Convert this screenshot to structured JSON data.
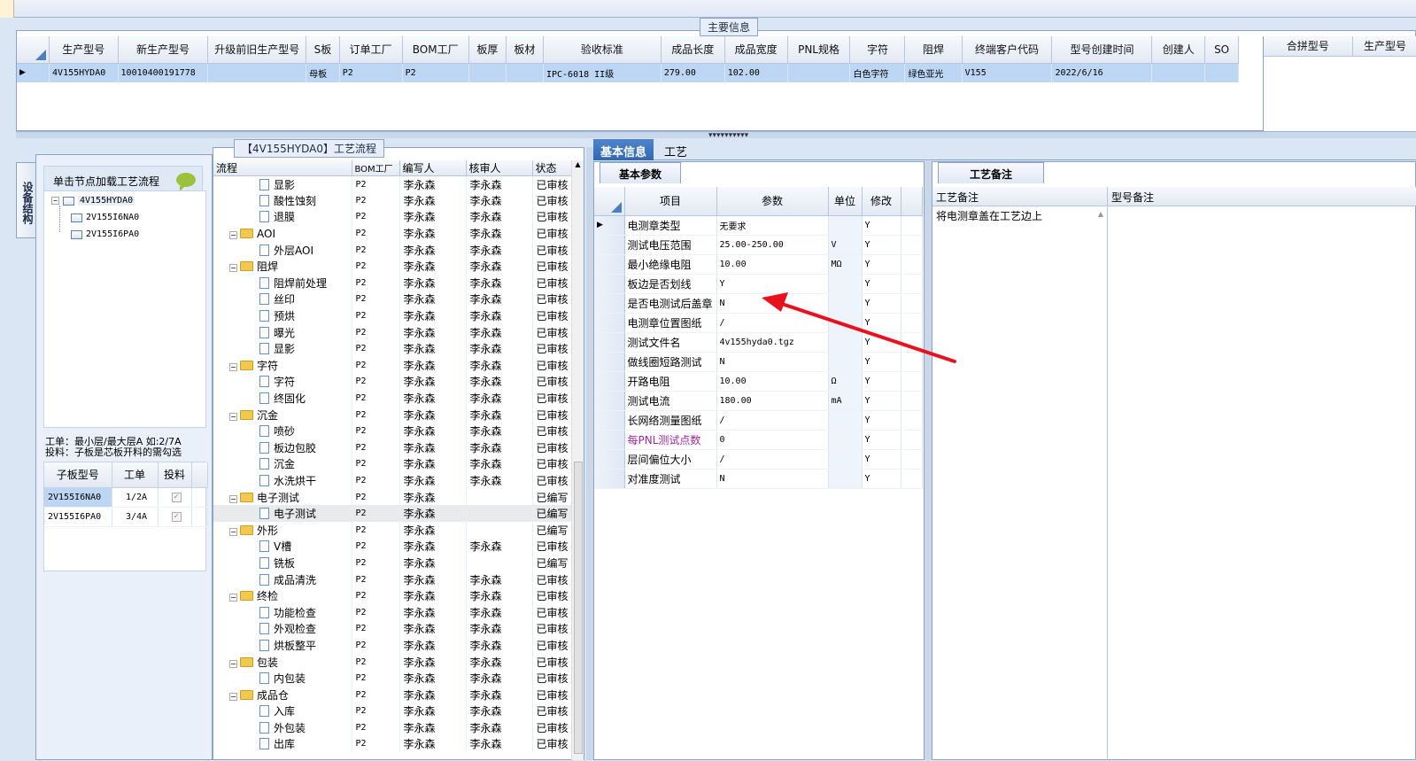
{
  "main_info": {
    "legend": "主要信息",
    "columns": [
      "生产型号",
      "新生产型号",
      "升级前旧生产型号",
      "S板",
      "订单工厂",
      "BOM工厂",
      "板厚",
      "板材",
      "验收标准",
      "成品长度",
      "成品宽度",
      "PNL规格",
      "字符",
      "阻焊",
      "终端客户代码",
      "型号创建时间",
      "创建人",
      "SO"
    ],
    "row": [
      "4V155HYDA0",
      "10010400191778",
      "",
      "母板",
      "P2",
      "P2",
      "",
      "",
      "IPC-6018 II级",
      "279.00",
      "102.00",
      "",
      "白色字符",
      "绿色亚光",
      "V155",
      "2022/6/16",
      "",
      ""
    ],
    "right_columns": [
      "合拼型号",
      "生产型号"
    ]
  },
  "left_panel": {
    "side_tab": "设备结构",
    "hint": "单击节点加载工艺流程",
    "tree": [
      {
        "label": "4V155HYDA0",
        "level": 0,
        "expanded": true
      },
      {
        "label": "2V155I6NA0",
        "level": 1
      },
      {
        "label": "2V155I6PA0",
        "level": 1
      }
    ],
    "note_line1": "工单：最小层/最大层A 如:2/7A",
    "note_line2": "投料：子板是芯板开料的需勾选",
    "sub_columns": [
      "子板型号",
      "工单",
      "投料"
    ],
    "sub_rows": [
      {
        "model": "2V155I6NA0",
        "order": "1/2A",
        "feed": "✓"
      },
      {
        "model": "2V155I6PA0",
        "order": "3/4A",
        "feed": "✓"
      }
    ]
  },
  "process": {
    "legend": "【4V155HYDA0】工艺流程",
    "columns": [
      "流程",
      "BOM工厂",
      "编写人",
      "核审人",
      "状态"
    ],
    "rows": [
      {
        "name": "显影",
        "type": "doc",
        "indent": 2,
        "bom": "P2",
        "writer": "李永森",
        "reviewer": "李永森",
        "status": "已审核"
      },
      {
        "name": "酸性蚀刻",
        "type": "doc",
        "indent": 2,
        "bom": "P2",
        "writer": "李永森",
        "reviewer": "李永森",
        "status": "已审核"
      },
      {
        "name": "退膜",
        "type": "doc",
        "indent": 2,
        "bom": "P2",
        "writer": "李永森",
        "reviewer": "李永森",
        "status": "已审核"
      },
      {
        "name": "AOI",
        "type": "folder",
        "indent": 1,
        "bom": "P2",
        "writer": "李永森",
        "reviewer": "李永森",
        "status": "已审核"
      },
      {
        "name": "外层AOI",
        "type": "doc",
        "indent": 2,
        "bom": "P2",
        "writer": "李永森",
        "reviewer": "李永森",
        "status": "已审核"
      },
      {
        "name": "阻焊",
        "type": "folder",
        "indent": 1,
        "bom": "P2",
        "writer": "李永森",
        "reviewer": "李永森",
        "status": "已审核"
      },
      {
        "name": "阻焊前处理",
        "type": "doc",
        "indent": 2,
        "bom": "P2",
        "writer": "李永森",
        "reviewer": "李永森",
        "status": "已审核"
      },
      {
        "name": "丝印",
        "type": "doc",
        "indent": 2,
        "bom": "P2",
        "writer": "李永森",
        "reviewer": "李永森",
        "status": "已审核"
      },
      {
        "name": "预烘",
        "type": "doc",
        "indent": 2,
        "bom": "P2",
        "writer": "李永森",
        "reviewer": "李永森",
        "status": "已审核"
      },
      {
        "name": "曝光",
        "type": "doc",
        "indent": 2,
        "bom": "P2",
        "writer": "李永森",
        "reviewer": "李永森",
        "status": "已审核"
      },
      {
        "name": "显影",
        "type": "doc",
        "indent": 2,
        "bom": "P2",
        "writer": "李永森",
        "reviewer": "李永森",
        "status": "已审核"
      },
      {
        "name": "字符",
        "type": "folder",
        "indent": 1,
        "bom": "P2",
        "writer": "李永森",
        "reviewer": "李永森",
        "status": "已审核"
      },
      {
        "name": "字符",
        "type": "doc",
        "indent": 2,
        "bom": "P2",
        "writer": "李永森",
        "reviewer": "李永森",
        "status": "已审核"
      },
      {
        "name": "终固化",
        "type": "doc",
        "indent": 2,
        "bom": "P2",
        "writer": "李永森",
        "reviewer": "李永森",
        "status": "已审核"
      },
      {
        "name": "沉金",
        "type": "folder",
        "indent": 1,
        "bom": "P2",
        "writer": "李永森",
        "reviewer": "李永森",
        "status": "已审核"
      },
      {
        "name": "喷砂",
        "type": "doc",
        "indent": 2,
        "bom": "P2",
        "writer": "李永森",
        "reviewer": "李永森",
        "status": "已审核"
      },
      {
        "name": "板边包胶",
        "type": "doc",
        "indent": 2,
        "bom": "P2",
        "writer": "李永森",
        "reviewer": "李永森",
        "status": "已审核"
      },
      {
        "name": "沉金",
        "type": "doc",
        "indent": 2,
        "bom": "P2",
        "writer": "李永森",
        "reviewer": "李永森",
        "status": "已审核"
      },
      {
        "name": "水洗烘干",
        "type": "doc",
        "indent": 2,
        "bom": "P2",
        "writer": "李永森",
        "reviewer": "李永森",
        "status": "已审核"
      },
      {
        "name": "电子测试",
        "type": "folder",
        "indent": 1,
        "bom": "P2",
        "writer": "李永森",
        "reviewer": "",
        "status": "已编写"
      },
      {
        "name": "电子测试",
        "type": "doc",
        "indent": 2,
        "bom": "P2",
        "writer": "李永森",
        "reviewer": "",
        "status": "已编写",
        "highlight": true
      },
      {
        "name": "外形",
        "type": "folder",
        "indent": 1,
        "bom": "P2",
        "writer": "李永森",
        "reviewer": "",
        "status": "已编写"
      },
      {
        "name": "V槽",
        "type": "doc",
        "indent": 2,
        "bom": "P2",
        "writer": "李永森",
        "reviewer": "李永森",
        "status": "已审核"
      },
      {
        "name": "铣板",
        "type": "doc",
        "indent": 2,
        "bom": "P2",
        "writer": "李永森",
        "reviewer": "",
        "status": "已编写"
      },
      {
        "name": "成品清洗",
        "type": "doc",
        "indent": 2,
        "bom": "P2",
        "writer": "李永森",
        "reviewer": "李永森",
        "status": "已审核"
      },
      {
        "name": "终检",
        "type": "folder",
        "indent": 1,
        "bom": "P2",
        "writer": "李永森",
        "reviewer": "李永森",
        "status": "已审核"
      },
      {
        "name": "功能检查",
        "type": "doc",
        "indent": 2,
        "bom": "P2",
        "writer": "李永森",
        "reviewer": "李永森",
        "status": "已审核"
      },
      {
        "name": "外观检查",
        "type": "doc",
        "indent": 2,
        "bom": "P2",
        "writer": "李永森",
        "reviewer": "李永森",
        "status": "已审核"
      },
      {
        "name": "烘板整平",
        "type": "doc",
        "indent": 2,
        "bom": "P2",
        "writer": "李永森",
        "reviewer": "李永森",
        "status": "已审核"
      },
      {
        "name": "包装",
        "type": "folder",
        "indent": 1,
        "bom": "P2",
        "writer": "李永森",
        "reviewer": "李永森",
        "status": "已审核"
      },
      {
        "name": "内包装",
        "type": "doc",
        "indent": 2,
        "bom": "P2",
        "writer": "李永森",
        "reviewer": "李永森",
        "status": "已审核"
      },
      {
        "name": "成品仓",
        "type": "folder",
        "indent": 1,
        "bom": "P2",
        "writer": "李永森",
        "reviewer": "李永森",
        "status": "已审核"
      },
      {
        "name": "入库",
        "type": "doc",
        "indent": 2,
        "bom": "P2",
        "writer": "李永森",
        "reviewer": "李永森",
        "status": "已审核"
      },
      {
        "name": "外包装",
        "type": "doc",
        "indent": 2,
        "bom": "P2",
        "writer": "李永森",
        "reviewer": "李永森",
        "status": "已审核"
      },
      {
        "name": "出库",
        "type": "doc",
        "indent": 2,
        "bom": "P2",
        "writer": "李永森",
        "reviewer": "李永森",
        "status": "已审核"
      }
    ]
  },
  "tabs": [
    "基本信息",
    "工艺"
  ],
  "basic_params": {
    "panel_tab": "基本参数",
    "columns": [
      "项目",
      "参数",
      "单位",
      "修改"
    ],
    "rows": [
      {
        "item": "电测章类型",
        "value": "无要求",
        "unit": "",
        "edit": "Y",
        "current": true
      },
      {
        "item": "测试电压范围",
        "value": "25.00-250.00",
        "unit": "V",
        "edit": "Y"
      },
      {
        "item": "最小绝缘电阻",
        "value": "10.00",
        "unit": "MΩ",
        "edit": "Y"
      },
      {
        "item": "板边是否划线",
        "value": "Y",
        "unit": "",
        "edit": "Y"
      },
      {
        "item": "是否电测试后盖章",
        "value": "N",
        "unit": "",
        "edit": "Y"
      },
      {
        "item": "电测章位置图纸",
        "value": "/",
        "unit": "",
        "edit": "Y"
      },
      {
        "item": "测试文件名",
        "value": "4v155hyda0.tgz",
        "unit": "",
        "edit": "Y"
      },
      {
        "item": "做线圈短路测试",
        "value": "N",
        "unit": "",
        "edit": "Y"
      },
      {
        "item": "开路电阻",
        "value": "10.00",
        "unit": "Ω",
        "edit": "Y"
      },
      {
        "item": "测试电流",
        "value": "180.00",
        "unit": "mA",
        "edit": "Y"
      },
      {
        "item": "长网络测量图纸",
        "value": "/",
        "unit": "",
        "edit": "Y"
      },
      {
        "item": "每PNL测试点数",
        "value": "0",
        "unit": "",
        "edit": "Y",
        "purple": true
      },
      {
        "item": "层间偏位大小",
        "value": "/",
        "unit": "",
        "edit": "Y"
      },
      {
        "item": "对准度测试",
        "value": "N",
        "unit": "",
        "edit": "Y"
      }
    ]
  },
  "notes": {
    "panel_tab": "工艺备注",
    "process_note_header": "工艺备注",
    "model_note_header": "型号备注",
    "process_note_text": "将电测章盖在工艺边上"
  },
  "colors": {
    "annotation_arrow": "#e8121f",
    "purple_label": "#9b2a9b",
    "selected_row": "#bcd6f4"
  }
}
